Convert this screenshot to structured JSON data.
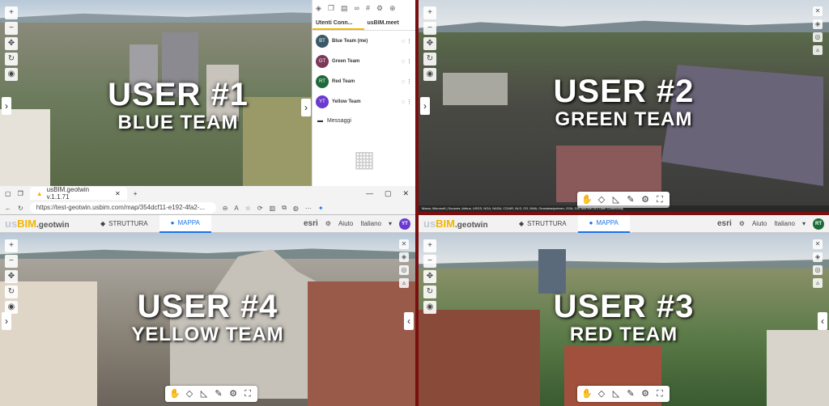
{
  "quadrants": {
    "q1": {
      "line1": "USER #1",
      "line2": "BLUE TEAM"
    },
    "q2": {
      "line1": "USER #2",
      "line2": "GREEN TEAM"
    },
    "q3": {
      "line1": "USER #3",
      "line2": "RED TEAM"
    },
    "q4": {
      "line1": "USER #4",
      "line2": "YELLOW TEAM"
    }
  },
  "panel": {
    "tabs": [
      "Utenti Conn...",
      "usBIM.meet"
    ],
    "users": [
      {
        "initials": "BT",
        "name": "Blue Team (me)",
        "color": "#3a5a6a"
      },
      {
        "initials": "GT",
        "name": "Green Team",
        "color": "#7a3a5a"
      },
      {
        "initials": "RT",
        "name": "Red Team",
        "color": "#1e6b3a"
      },
      {
        "initials": "YT",
        "name": "Yellow Team",
        "color": "#6a3ad0"
      }
    ],
    "messages_label": "Messaggi"
  },
  "browser": {
    "tab_title": "usBIM.geotwin v.1.1.71",
    "url": "https://test-geotwin.usbim.com/map/354dcf11-e192-4fa2-..."
  },
  "app_header": {
    "logo_us": "us",
    "logo_bim": "BIM",
    "logo_suffix": ".geotwin",
    "tab_struttura": "STRUTTURA",
    "tab_mappa": "MAPPA",
    "esri": "esri",
    "help": "Aiuto",
    "language": "Italiano",
    "avatar_q4": "YT",
    "avatar_q3": "RT"
  },
  "attribution": "Maxar, Microsoft | Sources: Airbus, USGS, NGA, NASA, CGIAR, NLS, OS, NMA, Geodatastyrelsen, GSA, GSI and the GIS User Community",
  "colors": {
    "accent": "#1a73e8",
    "brand_yellow": "#f4b400",
    "divider": "#7a0f0f"
  }
}
